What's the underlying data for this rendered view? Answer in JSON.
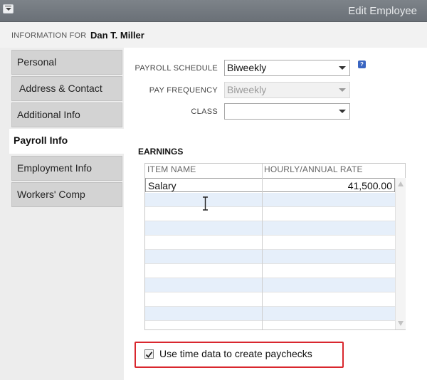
{
  "window": {
    "title": "Edit Employee"
  },
  "info": {
    "label": "INFORMATION FOR",
    "employee_name": "Dan T. Miller"
  },
  "tabs": [
    {
      "label": "Personal",
      "active": false
    },
    {
      "label": "Address & Contact",
      "active": false
    },
    {
      "label": "Additional Info",
      "active": false
    },
    {
      "label": "Payroll Info",
      "active": true
    },
    {
      "label": "Employment Info",
      "active": false
    },
    {
      "label": "Workers' Comp",
      "active": false
    }
  ],
  "form": {
    "payroll_schedule": {
      "label": "PAYROLL SCHEDULE",
      "value": "Biweekly"
    },
    "pay_frequency": {
      "label": "PAY FREQUENCY",
      "value": "Biweekly",
      "disabled": true
    },
    "class": {
      "label": "CLASS",
      "value": ""
    },
    "help_icon": "?"
  },
  "earnings": {
    "title": "EARNINGS",
    "columns": [
      "ITEM NAME",
      "HOURLY/ANNUAL RATE"
    ],
    "rows": [
      {
        "item": "Salary",
        "rate": "41,500.00"
      }
    ]
  },
  "time_data": {
    "label": "Use time data to create paychecks",
    "checked": true
  },
  "colors": {
    "highlight_border": "#d9272e",
    "alt_row": "#e6effa",
    "help_icon": "#3a66c2"
  },
  "icons": [
    "system-menu-icon",
    "help-icon",
    "text-cursor-icon",
    "scroll-up-icon",
    "scroll-down-icon",
    "checkmark-icon"
  ]
}
